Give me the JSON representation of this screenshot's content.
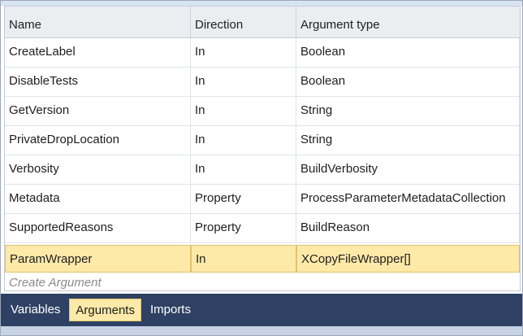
{
  "grid": {
    "columns": [
      "Name",
      "Direction",
      "Argument type"
    ],
    "rows": [
      {
        "name": "CreateLabel",
        "direction": "In",
        "type": "Boolean"
      },
      {
        "name": "DisableTests",
        "direction": "In",
        "type": "Boolean"
      },
      {
        "name": "GetVersion",
        "direction": "In",
        "type": "String"
      },
      {
        "name": "PrivateDropLocation",
        "direction": "In",
        "type": "String"
      },
      {
        "name": "Verbosity",
        "direction": "In",
        "type": "BuildVerbosity"
      },
      {
        "name": "Metadata",
        "direction": "Property",
        "type": "ProcessParameterMetadataCollection"
      },
      {
        "name": "SupportedReasons",
        "direction": "Property",
        "type": "BuildReason"
      },
      {
        "name": "ParamWrapper",
        "direction": "In",
        "type": "XCopyFileWrapper[]"
      }
    ],
    "create_placeholder": "Create Argument"
  },
  "tabs": [
    "Variables",
    "Arguments",
    "Imports"
  ],
  "colors": {
    "selection": "#fde9a8",
    "tabbar": "#2e4164",
    "header": "#ebedf1"
  }
}
